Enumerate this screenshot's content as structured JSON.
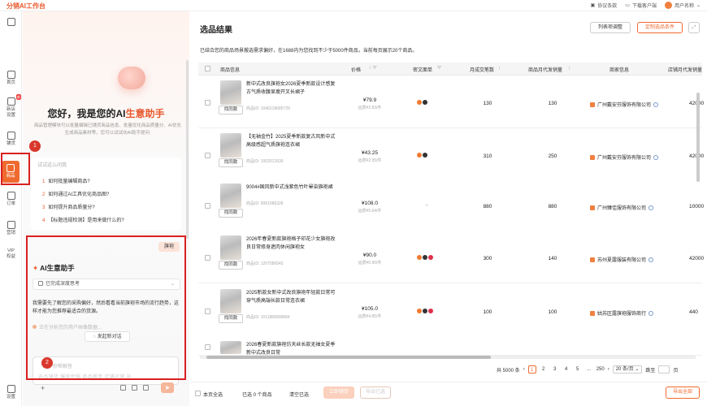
{
  "app": {
    "brand": "分销AI工作台"
  },
  "topbar": {
    "agreement": "协议条款",
    "download": "下载客户端",
    "user": "用户名称"
  },
  "sidebar": {
    "items": [
      {
        "label": "首页"
      },
      {
        "label": "新店\n设置",
        "badge": "新"
      },
      {
        "label": "铺货"
      },
      {
        "label": "商品"
      },
      {
        "label": "订单"
      },
      {
        "label": "营销"
      },
      {
        "label": "VIP\n权益"
      },
      {
        "label": "设置"
      }
    ]
  },
  "chat": {
    "greeting_prefix": "您好，我是您的AI",
    "greeting_highlight": "生意助手",
    "intro": "商品管理模块可以批量编辑已铺货商品信息、批量优化商品质量分、AI优化生成商品素材等，您可以试试向AI助手提问:",
    "questions_title": "试试这么问我",
    "questions": [
      {
        "num": "1",
        "text": "如何批量编辑商品?"
      },
      {
        "num": "2",
        "text": "如何通过AI工具优化商品图?"
      },
      {
        "num": "3",
        "text": "如何提升商品质量分?"
      },
      {
        "num": "4",
        "text": "【标题违规检测】是用来做什么的?"
      }
    ],
    "user_msg": "旗袍",
    "ai_title": "AI生意助手",
    "thinking": "已完成深度思考",
    "ai_text": "我需要先了解您的采购偏好，然后看看当前旗袍市场的流行趋势，这样才能为您推荐最适合的货源。",
    "analyzing": "正在分析您的用户画像数据...",
    "newchat": "发起新对话",
    "input_placeholder": "问，秒帮解答",
    "input_hint": "选品铺货  爆款挖掘  商品搬单  店铺运营  补"
  },
  "badges": {
    "one": "1",
    "two": "2",
    "three": "3"
  },
  "main": {
    "title": "选品结果",
    "subtitle": "已结合您的商品场景搬选需求偏好，在1688内为您找到不少于5000件商品，当前每页展示20个商品。",
    "btn_columns": "列表项调整",
    "btn_custom": "定制选品条件",
    "columns": [
      "商品信息",
      "价格",
      "密文面单",
      "月成交笔数",
      "商品月代发销量",
      "商家信息",
      "店铺月代发销量"
    ],
    "rows": [
      {
        "name": "新中式改良旗袍女2026夏季新款设计感复古气质收腰显瘦开叉长裙子",
        "id": "商品ID: 1046218685729",
        "price": "¥79.9",
        "ship": "运费¥2.83/件",
        "platform": true,
        "monthly": "130",
        "dropship": "130",
        "shop": "广州戴安芬服饰有限公司",
        "store": "42000"
      },
      {
        "name": "【无袖金竹】2025夏季新款复古风新中式高级感超气质旗袍连衣裙",
        "id": "商品ID: 1002512630",
        "price": "¥43.25",
        "ship": "运费¥2.35/件",
        "platform": true,
        "monthly": "310",
        "dropship": "250",
        "shop": "广州戴安芬服饰有限公司",
        "store": "42000"
      },
      {
        "name": "9004#国风新中式浅紫色竹叶晕染旗袍裙",
        "id": "商品ID: 9961586326",
        "price": "¥108.0",
        "ship": "运费¥5.64/件",
        "platform": false,
        "monthly": "880",
        "dropship": "880",
        "shop": "广州臻佳服饰有限公司",
        "store": "10000"
      },
      {
        "name": "2026年春夏新款旗袍格子印花少女旗袍改良日常修身遮肉休闲旗袍女",
        "id": "商品ID: 1207586543",
        "price": "¥90.0",
        "ship": "运费¥0.90/件",
        "platform": true,
        "monthly": "300",
        "dropship": "140",
        "shop": "苏州夏露服装有限公司",
        "store": "42000"
      },
      {
        "name": "2025新款女新中式改良旗袍年轻款日常可穿气质高端长款日常连衣裙",
        "id": "商品ID: 1011888908894",
        "price": "¥105.0",
        "ship": "运费¥4.85/件",
        "platform": true,
        "monthly": "100",
        "dropship": "100",
        "shop": "姑苏区露旗袍服饰商行",
        "store": "440"
      },
      {
        "name": "2026春夏新款旗袍仿天丝长款无袖女夏季新中式改良日常",
        "id": "",
        "price": "",
        "ship": "",
        "platform": false,
        "monthly": "",
        "dropship": "",
        "shop": "",
        "store": ""
      }
    ],
    "find_similar": "找同款",
    "pager": {
      "total": "共 5000 条",
      "pages": [
        "1",
        "2",
        "3",
        "4",
        "5",
        "...",
        "250"
      ],
      "size": "20 条/页",
      "goto": "跳至",
      "page_unit": "页"
    },
    "bottom": {
      "select_all": "本页全选",
      "selected": "已选 0 个商品",
      "clear": "清空已选",
      "btn_list": "立即铺货",
      "btn_export_sel": "导出已选",
      "btn_export_all": "导出全部"
    }
  }
}
